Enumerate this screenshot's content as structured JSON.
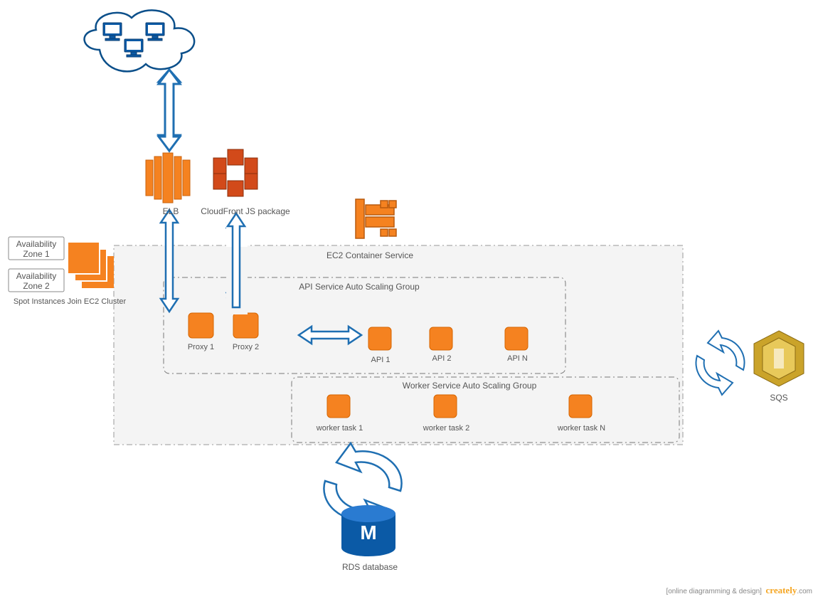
{
  "labels": {
    "elb": "ELB",
    "cloudfront": "CloudFront  JS package",
    "ec2_container": "EC2 Container Service",
    "api_group": "API Service Auto Scaling Group",
    "worker_group": "Worker Service Auto Scaling Group",
    "proxy1": "Proxy 1",
    "proxy2": "Proxy 2",
    "api1": "API 1",
    "api2": "API 2",
    "apin": "API  N",
    "worker1": "worker task 1",
    "worker2": "worker task 2",
    "workern": "worker task N",
    "az1": "Availability Zone 1",
    "az2": "Availability Zone 2",
    "spot": "Spot Instances Join EC2 Cluster",
    "sqs": "SQS",
    "rds": "RDS database"
  },
  "footer": {
    "tag": "[online diagramming & design]",
    "brand": "creately",
    "suffix": ".com"
  }
}
